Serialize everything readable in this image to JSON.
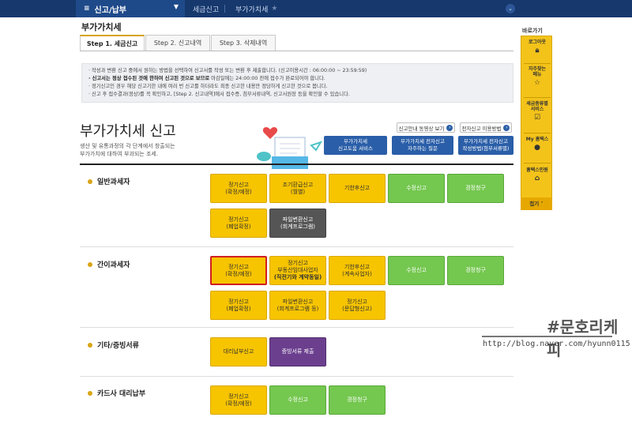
{
  "topbar": {
    "menu_label": "신고/납부",
    "crumb1": "세금신고",
    "crumb2": "부가가치세"
  },
  "page_title": "부가가치세",
  "tabs": [
    {
      "label": "Step 1. 세금신고"
    },
    {
      "label": "Step 2. 신고내역"
    },
    {
      "label": "Step 3. 삭제내역"
    }
  ],
  "notice": [
    {
      "text": "· 작성과 변환 신고 중에서 원하는 방법을 선택하여 신고서를 작성 또는 변환 후 제출합니다. (신고이용시간 : 06:00:00 ~ 23:59:59)"
    },
    {
      "strong": "· 신고서는 정상 접수된 것에 한하여 신고된 것으로 보므로",
      "text": " 마감일에는 24:00:00 전에 접수가 완료되어야 합니다."
    },
    {
      "text": "· 정기신고인 경우 해당 신고기한 내에 여러 번 신고를 하더라도 최종 신고한 내용만 정당하게 신고한 것으로 봅니다."
    },
    {
      "text": "· 신고 후 접수결과(정상)를 꼭 확인하고, [Step 2. 신고내역]에서 접수증, 첨부서류내역, 신고서원장 등을 확인할 수 있습니다."
    }
  ],
  "heading": {
    "title": "부가가치세 신고",
    "desc_line1": "생산 및 유통과정의 각 단계에서 창출되는",
    "desc_line2": "부가가치에 대하여 부과되는 조세."
  },
  "links": {
    "video": "신고안내 동영상 보기",
    "guide": "전자신고 이용방법"
  },
  "services": [
    {
      "line1": "부가가치세",
      "line2": "신고도움 서비스"
    },
    {
      "line1": "부가가치세 전자신고",
      "line2": "자주하는 질문"
    },
    {
      "line1": "부가가치세 전자신고",
      "line2": "작성방법(첨부서류별)"
    }
  ],
  "sections": {
    "general": {
      "label": "일반과세자",
      "buttons": [
        {
          "l1": "정기신고",
          "l2": "(확정/예정)"
        },
        {
          "l1": "조기환급신고",
          "l2": "(월별)"
        },
        {
          "l1": "기한후신고",
          "l2": ""
        },
        {
          "l1": "수정신고",
          "l2": ""
        },
        {
          "l1": "경정청구",
          "l2": ""
        },
        {
          "l1": "정기신고",
          "l2": "(폐업확정)"
        },
        {
          "l1": "파일변환신고",
          "l2": "(회계프로그램)"
        }
      ]
    },
    "simple": {
      "label": "간이과세자",
      "buttons": [
        {
          "l1": "정기신고",
          "l2": "(확정/예정)"
        },
        {
          "l1": "정기신고",
          "l2": "부동산임대사업자",
          "l3": "(직전기와 계약동일)"
        },
        {
          "l1": "기한후신고",
          "l2": "(계속사업자)"
        },
        {
          "l1": "수정신고",
          "l2": ""
        },
        {
          "l1": "경정청구",
          "l2": ""
        },
        {
          "l1": "정기신고",
          "l2": "(폐업확정)"
        },
        {
          "l1": "파일변환신고",
          "l2": "(회계프로그램 등)"
        },
        {
          "l1": "정기신고",
          "l2": "(문답형신고)"
        }
      ]
    },
    "etc": {
      "label": "기타/증빙서류",
      "buttons": [
        {
          "l1": "대리납부신고",
          "l2": ""
        },
        {
          "l1": "증빙서류 제출",
          "l2": ""
        }
      ]
    },
    "card": {
      "label": "카드사 대리납부",
      "buttons": [
        {
          "l1": "정기신고",
          "l2": "(확정/예정)"
        },
        {
          "l1": "수정신고",
          "l2": ""
        },
        {
          "l1": "경정청구",
          "l2": ""
        }
      ]
    }
  },
  "quick_panel": {
    "title": "바로가기",
    "items": [
      {
        "label": "로그아웃",
        "icon": "lock-icon"
      },
      {
        "label": "자주찾는 메뉴",
        "icon": "star-icon"
      },
      {
        "label": "세금종류별 서비스",
        "icon": "check-icon"
      },
      {
        "label": "My 홈택스",
        "icon": "user-icon"
      },
      {
        "label": "홈택스민원",
        "icon": "home-icon"
      }
    ],
    "close_label": "접기"
  },
  "watermark": {
    "tag": "#문호리케피",
    "url": "http://blog.naver.com/hyunn0115"
  },
  "colors": {
    "nav": "#16386d",
    "yellow": "#f7c400",
    "green": "#74c74f",
    "purple": "#6b3f8e",
    "dark": "#555555",
    "blue": "#2a5ea8"
  }
}
